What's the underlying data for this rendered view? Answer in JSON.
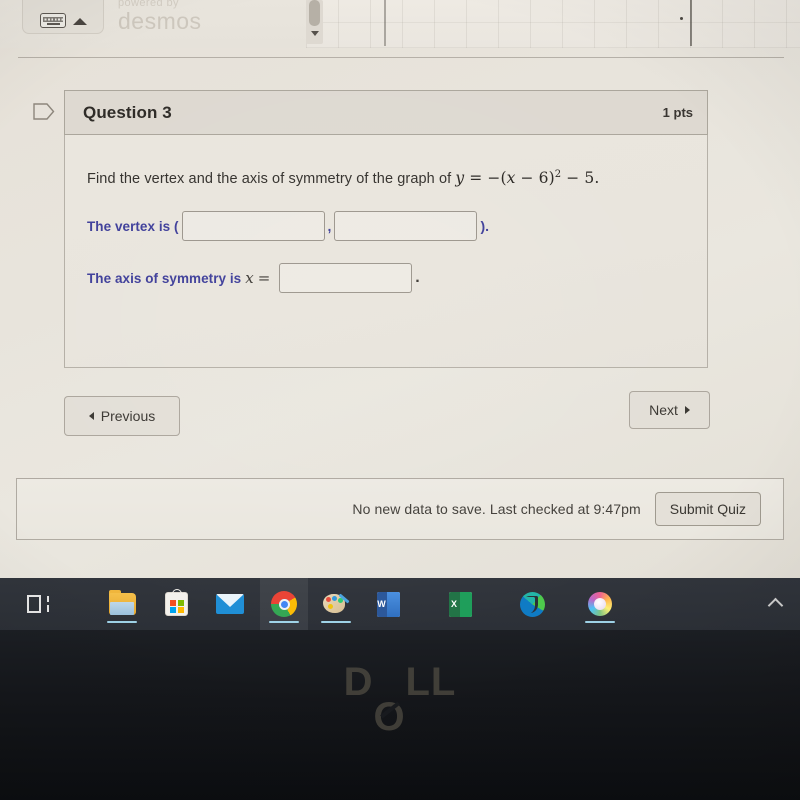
{
  "desmos": {
    "keyboard_icon": "keyboard-icon",
    "collapse_icon": "caret-up-icon",
    "powered_by": "powered by",
    "brand": "desmos",
    "scroll_icon": "scrollbar-down-arrow"
  },
  "question": {
    "flag_icon": "flag-icon",
    "title": "Question 3",
    "points": "1 pts",
    "prompt_prefix": "Find the vertex and the axis of symmetry of the graph of ",
    "equation": {
      "lhs": "y",
      "equals": "=",
      "rhs_lead": "−(",
      "rhs_var": "x",
      "rhs_minus": "−",
      "rhs_num": "6",
      "rhs_close": ")",
      "exponent": "2",
      "rhs_tail": "− 5",
      "period": "."
    },
    "vertex": {
      "label": "The vertex is (",
      "x_value": "",
      "x_placeholder": "",
      "separator": ",",
      "y_value": "",
      "y_placeholder": "",
      "close": ")."
    },
    "axis": {
      "label": "The axis of symmetry is",
      "variable": "x",
      "equals": "=",
      "value": "",
      "placeholder": "",
      "period": "."
    }
  },
  "nav": {
    "previous_label": "Previous",
    "previous_icon": "triangle-left-icon",
    "next_label": "Next",
    "next_icon": "triangle-right-icon"
  },
  "save_bar": {
    "status": "No new data to save. Last checked at 9:47pm",
    "submit_label": "Submit Quiz"
  },
  "taskbar": {
    "items": [
      {
        "name": "task-view",
        "label": "Task View"
      },
      {
        "name": "file-explorer",
        "label": "File Explorer",
        "active": true
      },
      {
        "name": "microsoft-store",
        "label": "Microsoft Store"
      },
      {
        "name": "mail",
        "label": "Mail"
      },
      {
        "name": "google-chrome",
        "label": "Google Chrome",
        "active": true
      },
      {
        "name": "paint",
        "label": "Paint",
        "active": true
      },
      {
        "name": "microsoft-word",
        "label": "Word"
      },
      {
        "name": "microsoft-excel",
        "label": "Excel"
      },
      {
        "name": "microsoft-edge",
        "label": "Microsoft Edge"
      },
      {
        "name": "photos-app",
        "label": "Photos",
        "active": true
      }
    ],
    "tray_icon": "chevron-up-icon"
  },
  "device": {
    "brand_d": "D",
    "brand_o": "O",
    "brand_ll": "LL"
  }
}
